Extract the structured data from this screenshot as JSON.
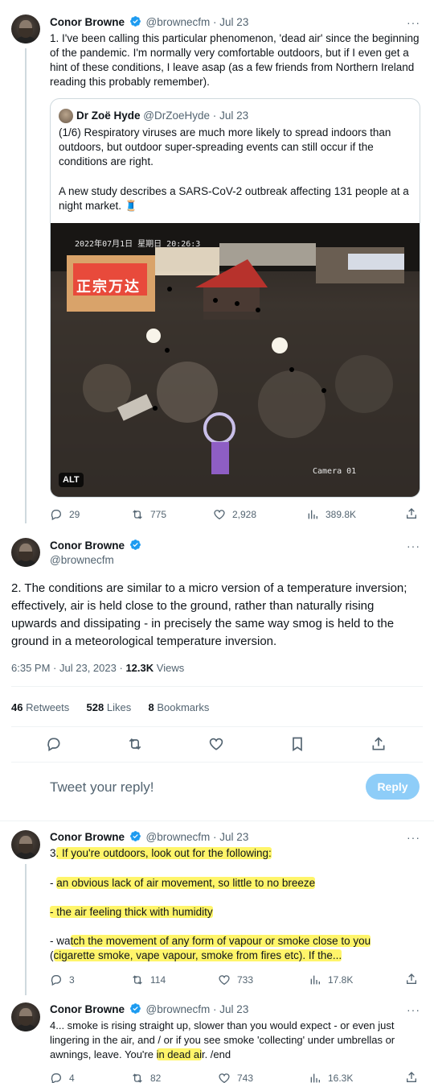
{
  "tweet1": {
    "name": "Conor Browne",
    "handle": "@brownecfm",
    "sep": "·",
    "date": "Jul 23",
    "more": "···",
    "text": "1. I've been calling this particular phenomenon, 'dead air' since the beginning of the pandemic. I'm normally very comfortable outdoors, but if I even get a hint of these conditions, I leave asap (as a few friends from Northern Ireland reading this probably remember).",
    "quote": {
      "name": "Dr Zoë Hyde",
      "handle": "@DrZoeHyde",
      "sep": "·",
      "date": "Jul 23",
      "para1": "(1/6) Respiratory viruses are much more likely to spread indoors than outdoors, but outdoor super-spreading events can still occur if the conditions are right.",
      "para2": "A new study describes a SARS-CoV-2 outbreak affecting 131 people at a night market. 🧵",
      "image_timestamp": "2022年07月1日 星期日 20:26:3",
      "image_sign": "正宗万达",
      "image_camera": "Camera 01",
      "alt_badge": "ALT"
    },
    "actions": {
      "replies": "29",
      "retweets": "775",
      "likes": "2,928",
      "views": "389.8K"
    }
  },
  "main_tweet": {
    "name": "Conor Browne",
    "handle": "@brownecfm",
    "more": "···",
    "text": "2. The conditions are similar to a micro version of a temperature inversion; effectively, air is held close to the ground, rather than naturally rising upwards and dissipating - in precisely the same way smog is held to the ground in a meteorological temperature inversion.",
    "time": "6:35 PM",
    "sep": "·",
    "date": "Jul 23, 2023",
    "sep2": "·",
    "views_count": "12.3K",
    "views_label": "Views",
    "retweets_count": "46",
    "retweets_label": "Retweets",
    "likes_count": "528",
    "likes_label": "Likes",
    "bookmarks_count": "8",
    "bookmarks_label": "Bookmarks"
  },
  "reply_box": {
    "placeholder": "Tweet your reply!",
    "button": "Reply"
  },
  "tweet3": {
    "name": "Conor Browne",
    "handle": "@brownecfm",
    "sep": "·",
    "date": "Jul 23",
    "more": "···",
    "line1a": "3",
    "line1b": ". If you're outdoors, look out for the following:",
    "line2a": "- ",
    "line2b": "an obvious lack of air movement, so little to no breeze",
    "line3": "- the air feeling thick with humidity",
    "line4a": "- wa",
    "line4b": "tch the movement of any form of vapour or smoke close to you",
    "line5a": "(",
    "line5b": "cigarette smoke, vape vapour, smoke from fires etc). If the...",
    "actions": {
      "replies": "3",
      "retweets": "114",
      "likes": "733",
      "views": "17.8K"
    }
  },
  "tweet4": {
    "name": "Conor Browne",
    "handle": "@brownecfm",
    "sep": "·",
    "date": "Jul 23",
    "more": "···",
    "line1": "4... smoke is rising straight up, slower than you would expect - or even just",
    "line2": "lingering in the air, and / or if you see smoke 'collecting' under umbrellas or",
    "line3a": "awnings, leave. You're ",
    "line3b": "in dead ai",
    "line3c": "r. /end",
    "actions": {
      "replies": "4",
      "retweets": "82",
      "likes": "743",
      "views": "16.3K"
    }
  },
  "colors": {
    "accent": "#1d9bf0",
    "reply_button": "#8ecdf8",
    "highlight": "#fff56a",
    "muted": "#536471"
  }
}
